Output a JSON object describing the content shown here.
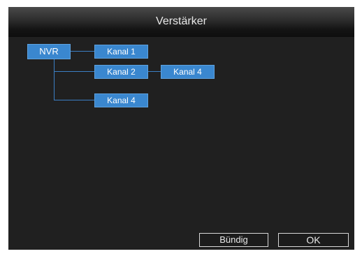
{
  "window": {
    "title": "Verstärker"
  },
  "tree": {
    "root": "NVR",
    "nodes": [
      "Kanal 1",
      "Kanal 2",
      "Kanal 4",
      "Kanal 4"
    ]
  },
  "buttons": {
    "align": "Bündig",
    "ok": "OK"
  },
  "colors": {
    "node": "#3a87cf",
    "connector": "#3b7fc4",
    "background": "#202020"
  }
}
